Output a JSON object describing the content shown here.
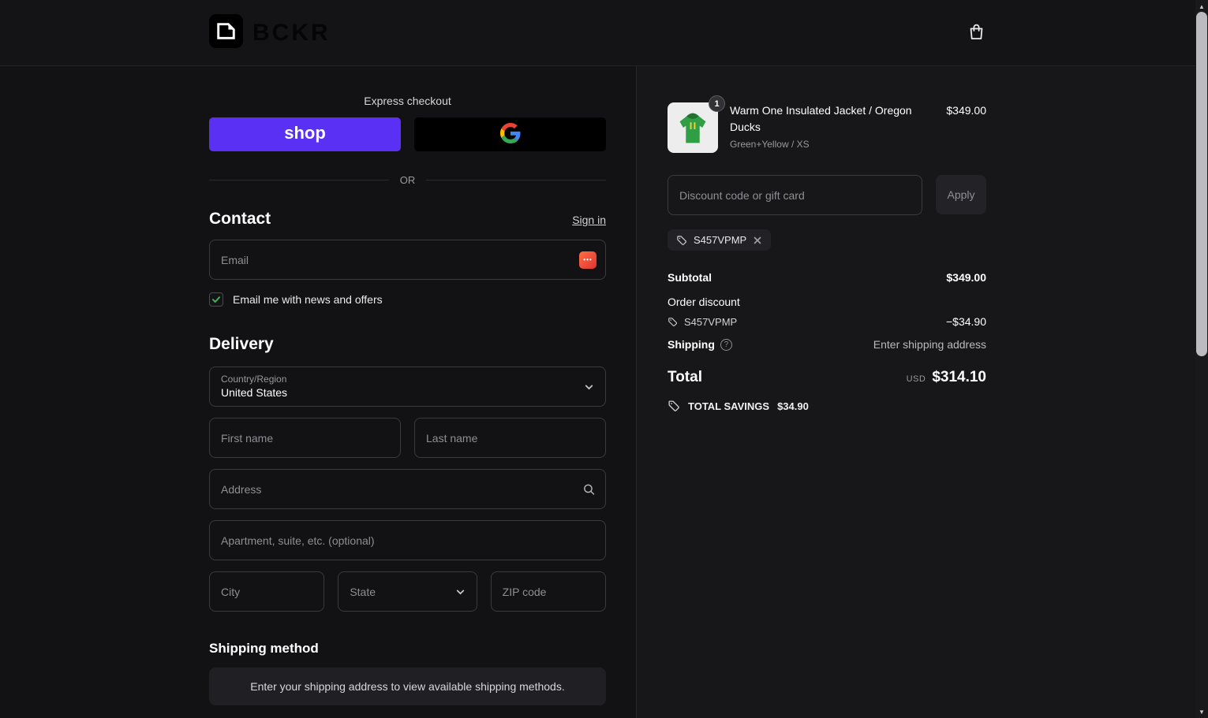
{
  "header": {
    "brand": "BCKR"
  },
  "express": {
    "title": "Express checkout",
    "shop_pay_label": "shop",
    "divider": "OR"
  },
  "contact": {
    "heading": "Contact",
    "sign_in_link": "Sign in",
    "email_placeholder": "Email",
    "newsletter_label": "Email me with news and offers",
    "newsletter_checked": true
  },
  "delivery": {
    "heading": "Delivery",
    "country_label": "Country/Region",
    "country_value": "United States",
    "first_name_placeholder": "First name",
    "last_name_placeholder": "Last name",
    "address_placeholder": "Address",
    "apartment_placeholder": "Apartment, suite, etc. (optional)",
    "city_placeholder": "City",
    "state_label": "State",
    "zip_placeholder": "ZIP code"
  },
  "shipping_method": {
    "heading": "Shipping method",
    "empty_notice": "Enter your shipping address to view available shipping methods."
  },
  "order_summary": {
    "item": {
      "quantity": "1",
      "title": "Warm One Insulated Jacket / Oregon Ducks",
      "variant": "Green+Yellow / XS",
      "price": "$349.00"
    },
    "discount_input": {
      "placeholder": "Discount code or gift card",
      "apply_label": "Apply"
    },
    "applied_discount_chip": "S457VPMP",
    "totals": {
      "subtotal_label": "Subtotal",
      "subtotal_value": "$349.00",
      "order_discount_label": "Order discount",
      "order_discount_code": "S457VPMP",
      "order_discount_value": "−$34.90",
      "shipping_label": "Shipping",
      "shipping_value": "Enter shipping address",
      "total_label": "Total",
      "currency_code": "USD",
      "total_value": "$314.10"
    },
    "savings": {
      "label": "TOTAL SAVINGS",
      "value": "$34.90"
    }
  },
  "colors": {
    "shop_pay_purple": "#5a31f4",
    "checkbox_green": "#3cb353",
    "background_dark": "#121214",
    "summary_background": "#17171a"
  }
}
